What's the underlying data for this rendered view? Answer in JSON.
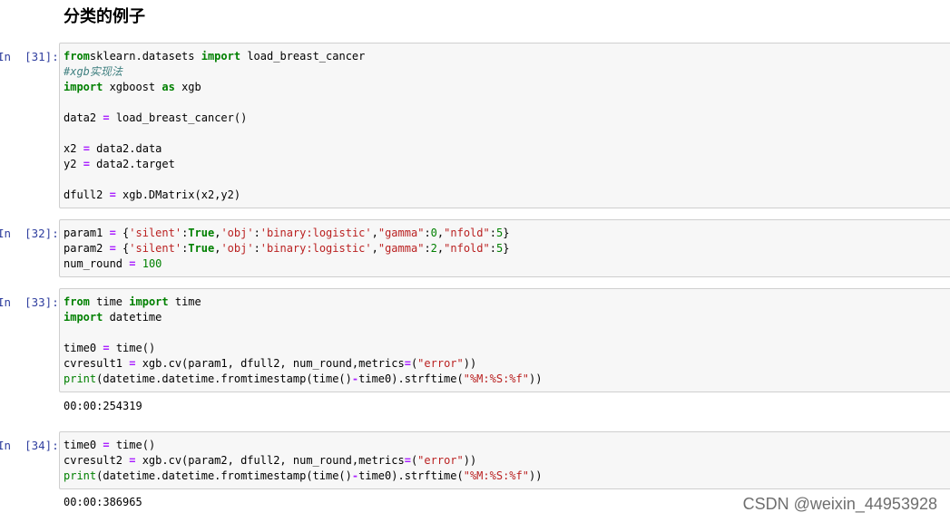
{
  "heading": "分类的例子",
  "cells": [
    {
      "prompt": "In  [31]:",
      "lines": [
        [
          [
            "kw",
            "from"
          ],
          [
            "",
            "sklearn.datasets "
          ],
          [
            "kw",
            "import"
          ],
          [
            "",
            " load_breast_cancer"
          ]
        ],
        [
          [
            "cm",
            "#xgb实现法"
          ]
        ],
        [
          [
            "kw",
            "import"
          ],
          [
            "",
            " xgboost "
          ],
          [
            "kw",
            "as"
          ],
          [
            "",
            " xgb"
          ]
        ],
        [],
        [
          [
            "",
            "data2 "
          ],
          [
            "op",
            "="
          ],
          [
            "",
            " load_breast_cancer()"
          ]
        ],
        [],
        [
          [
            "",
            "x2 "
          ],
          [
            "op",
            "="
          ],
          [
            "",
            " data2.data"
          ]
        ],
        [
          [
            "",
            "y2 "
          ],
          [
            "op",
            "="
          ],
          [
            "",
            " data2.target"
          ]
        ],
        [],
        [
          [
            "",
            "dfull2 "
          ],
          [
            "op",
            "="
          ],
          [
            "",
            " xgb.DMatrix(x2,y2)"
          ]
        ]
      ]
    },
    {
      "prompt": "In  [32]:",
      "lines": [
        [
          [
            "",
            "param1 "
          ],
          [
            "op",
            "="
          ],
          [
            "",
            " {"
          ],
          [
            "st",
            "'silent'"
          ],
          [
            "",
            ":"
          ],
          [
            "kw",
            "True"
          ],
          [
            "",
            ","
          ],
          [
            "st",
            "'obj'"
          ],
          [
            "",
            ":"
          ],
          [
            "st",
            "'binary:logistic'"
          ],
          [
            "",
            ","
          ],
          [
            "st",
            "\"gamma\""
          ],
          [
            "",
            ":"
          ],
          [
            "nu",
            "0"
          ],
          [
            "",
            ","
          ],
          [
            "st",
            "\"nfold\""
          ],
          [
            "",
            ":"
          ],
          [
            "nu",
            "5"
          ],
          [
            "",
            "}"
          ]
        ],
        [
          [
            "",
            "param2 "
          ],
          [
            "op",
            "="
          ],
          [
            "",
            " {"
          ],
          [
            "st",
            "'silent'"
          ],
          [
            "",
            ":"
          ],
          [
            "kw",
            "True"
          ],
          [
            "",
            ","
          ],
          [
            "st",
            "'obj'"
          ],
          [
            "",
            ":"
          ],
          [
            "st",
            "'binary:logistic'"
          ],
          [
            "",
            ","
          ],
          [
            "st",
            "\"gamma\""
          ],
          [
            "",
            ":"
          ],
          [
            "nu",
            "2"
          ],
          [
            "",
            ","
          ],
          [
            "st",
            "\"nfold\""
          ],
          [
            "",
            ":"
          ],
          [
            "nu",
            "5"
          ],
          [
            "",
            "}"
          ]
        ],
        [
          [
            "",
            "num_round "
          ],
          [
            "op",
            "="
          ],
          [
            "",
            " "
          ],
          [
            "nu",
            "100"
          ]
        ]
      ]
    },
    {
      "prompt": "In  [33]:",
      "lines": [
        [
          [
            "kw",
            "from"
          ],
          [
            "",
            " time "
          ],
          [
            "kw",
            "import"
          ],
          [
            "",
            " time"
          ]
        ],
        [
          [
            "kw",
            "import"
          ],
          [
            "",
            " datetime"
          ]
        ],
        [],
        [
          [
            "",
            "time0 "
          ],
          [
            "op",
            "="
          ],
          [
            "",
            " time()"
          ]
        ],
        [
          [
            "",
            "cvresult1 "
          ],
          [
            "op",
            "="
          ],
          [
            "",
            " xgb.cv(param1, dfull2, num_round,metrics"
          ],
          [
            "op",
            "="
          ],
          [
            "",
            "("
          ],
          [
            "st",
            "\"error\""
          ],
          [
            "",
            "))"
          ]
        ],
        [
          [
            "bi",
            "print"
          ],
          [
            "",
            "(datetime.datetime.fromtimestamp(time()"
          ],
          [
            "op",
            "-"
          ],
          [
            "",
            "time0).strftime("
          ],
          [
            "st",
            "\"%M:%S:%f\""
          ],
          [
            "",
            "))"
          ]
        ]
      ],
      "output": "00:00:254319"
    },
    {
      "prompt": "In  [34]:",
      "lines": [
        [
          [
            "",
            "time0 "
          ],
          [
            "op",
            "="
          ],
          [
            "",
            " time()"
          ]
        ],
        [
          [
            "",
            "cvresult2 "
          ],
          [
            "op",
            "="
          ],
          [
            "",
            " xgb.cv(param2, dfull2, num_round,metrics"
          ],
          [
            "op",
            "="
          ],
          [
            "",
            "("
          ],
          [
            "st",
            "\"error\""
          ],
          [
            "",
            "))"
          ]
        ],
        [
          [
            "bi",
            "print"
          ],
          [
            "",
            "(datetime.datetime.fromtimestamp(time()"
          ],
          [
            "op",
            "-"
          ],
          [
            "",
            "time0).strftime("
          ],
          [
            "st",
            "\"%M:%S:%f\""
          ],
          [
            "",
            "))"
          ]
        ]
      ],
      "output": "00:00:386965"
    }
  ],
  "watermark": "CSDN @weixin_44953928"
}
